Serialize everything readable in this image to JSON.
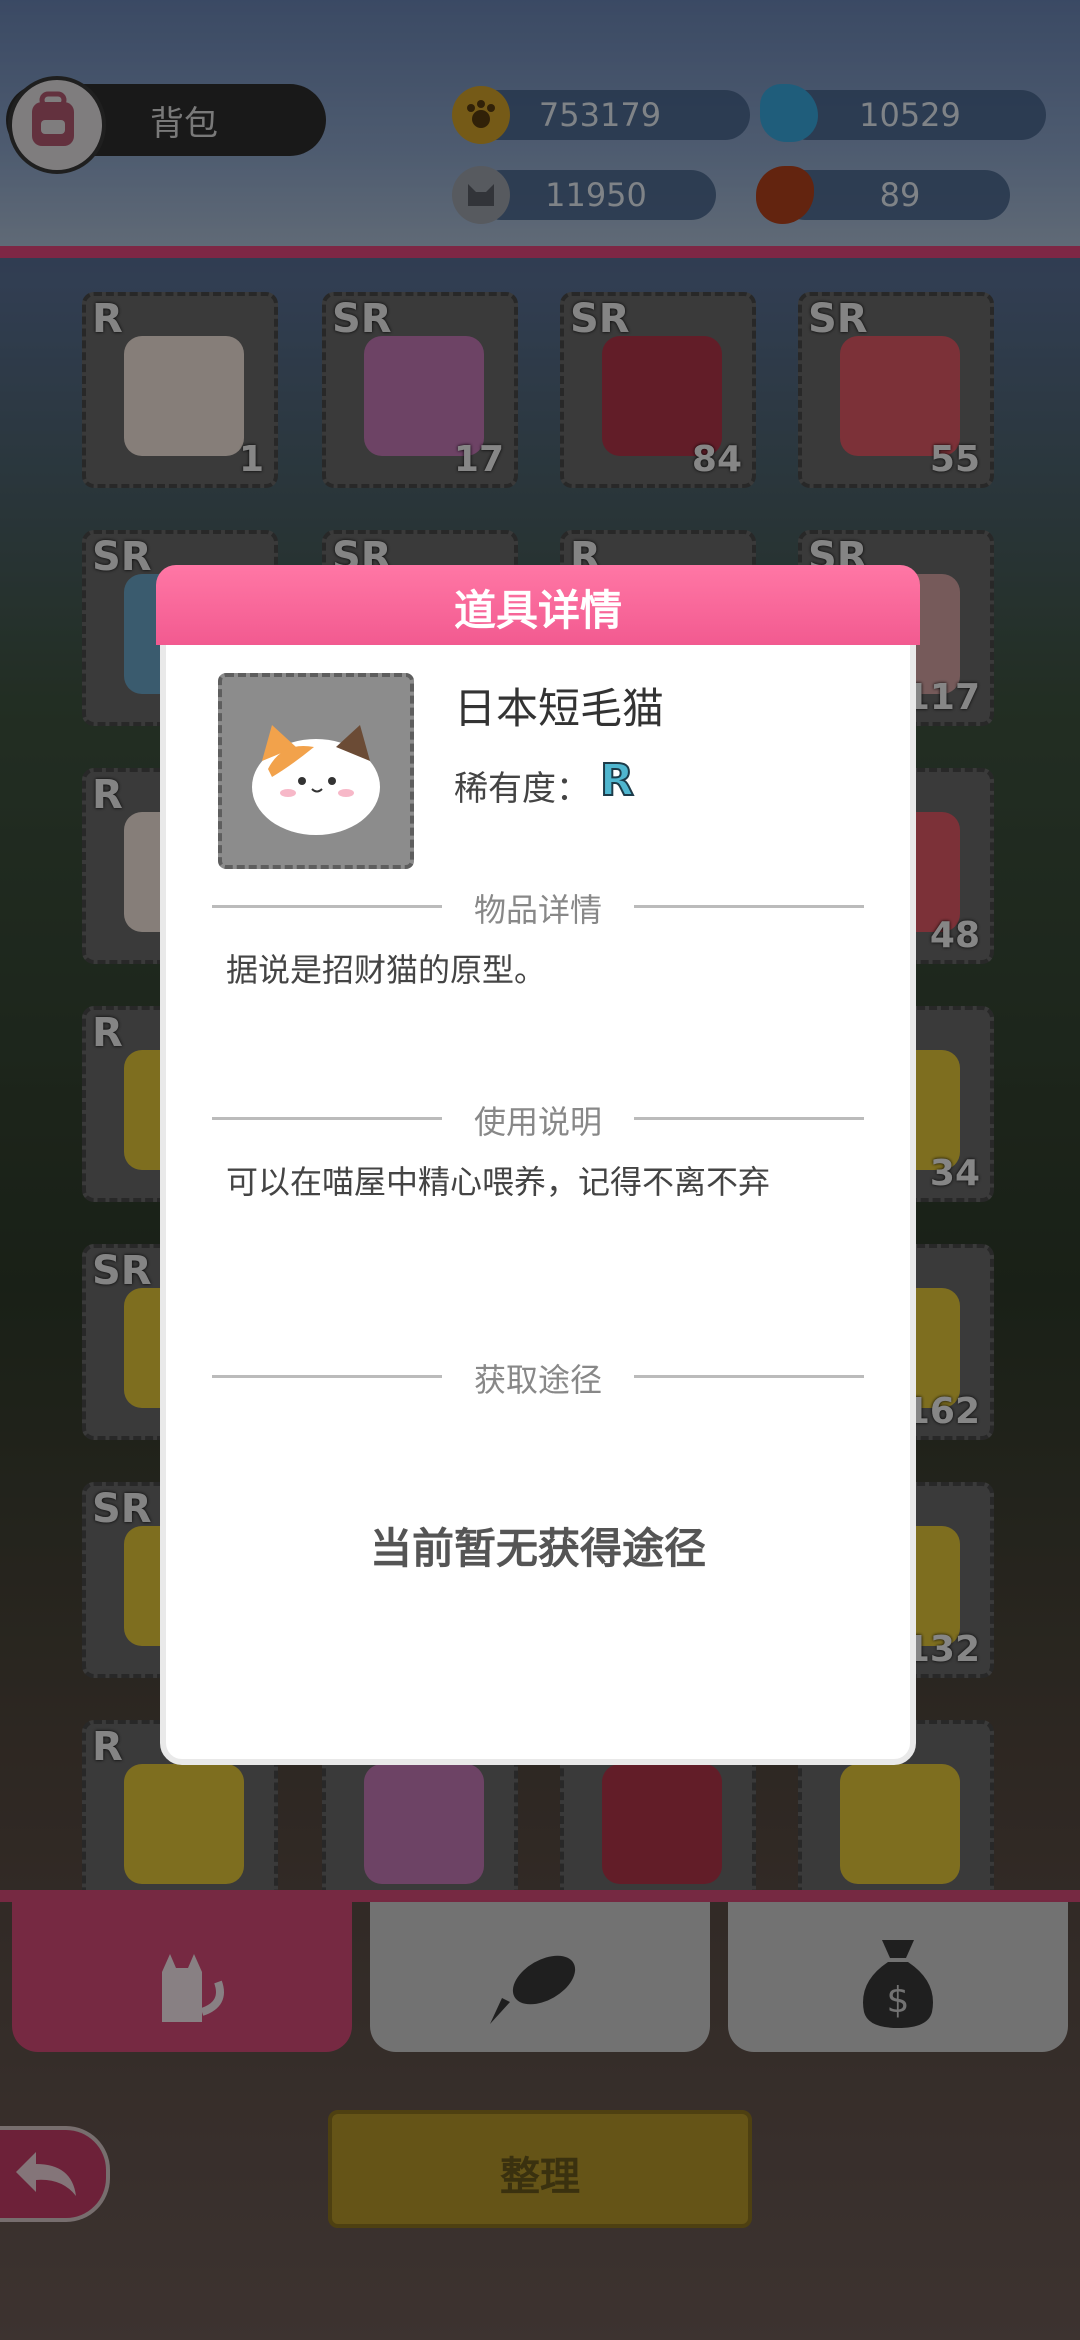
{
  "header": {
    "title": "背包",
    "currencies": [
      {
        "name": "paw-coin",
        "value": "753179"
      },
      {
        "name": "fish-point",
        "value": "10529"
      },
      {
        "name": "cat-token",
        "value": "11950"
      },
      {
        "name": "bean",
        "value": "89"
      }
    ]
  },
  "grid": {
    "items": [
      {
        "rarity": "R",
        "count": "1"
      },
      {
        "rarity": "SR",
        "count": "17"
      },
      {
        "rarity": "SR",
        "count": "84"
      },
      {
        "rarity": "SR",
        "count": "55"
      },
      {
        "rarity": "SR",
        "count": ""
      },
      {
        "rarity": "SR",
        "count": ""
      },
      {
        "rarity": "R",
        "count": ""
      },
      {
        "rarity": "SR",
        "count": "117"
      },
      {
        "rarity": "R",
        "count": ""
      },
      {
        "rarity": "",
        "count": ""
      },
      {
        "rarity": "",
        "count": ""
      },
      {
        "rarity": "",
        "count": "48"
      },
      {
        "rarity": "R",
        "count": ""
      },
      {
        "rarity": "",
        "count": ""
      },
      {
        "rarity": "",
        "count": ""
      },
      {
        "rarity": "",
        "count": "34"
      },
      {
        "rarity": "SR",
        "count": ""
      },
      {
        "rarity": "",
        "count": ""
      },
      {
        "rarity": "",
        "count": ""
      },
      {
        "rarity": "",
        "count": "162"
      },
      {
        "rarity": "SR",
        "count": ""
      },
      {
        "rarity": "",
        "count": ""
      },
      {
        "rarity": "",
        "count": ""
      },
      {
        "rarity": "",
        "count": "132"
      },
      {
        "rarity": "R",
        "count": ""
      },
      {
        "rarity": "",
        "count": ""
      },
      {
        "rarity": "",
        "count": ""
      },
      {
        "rarity": "",
        "count": ""
      }
    ]
  },
  "modal": {
    "title": "道具详情",
    "item_name": "日本短毛猫",
    "rarity_label": "稀有度：",
    "rarity_value": "R",
    "section_detail": "物品详情",
    "detail_text": "据说是招财猫的原型。",
    "section_usage": "使用说明",
    "usage_text": "可以在喵屋中精心喂养，记得不离不弃",
    "section_source": "获取途径",
    "source_text": "当前暂无获得途径"
  },
  "tabs": [
    {
      "icon": "cat-icon",
      "active": true
    },
    {
      "icon": "fish-icon",
      "active": false
    },
    {
      "icon": "money-bag-icon",
      "active": false
    }
  ],
  "bottom": {
    "sort_label": "整理"
  },
  "colors": {
    "accent_pink": "#f25a90",
    "tab_active": "#d84b79",
    "rarity_r": "#4fb6cf",
    "sort_gold": "#e2bd2f"
  }
}
